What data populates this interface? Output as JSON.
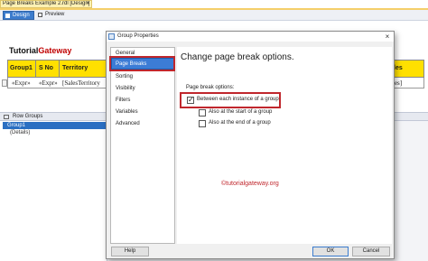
{
  "document": {
    "tab_title": "Page Breaks Example 2.rdl [Design]",
    "tab_close": "×",
    "design_label": "Design",
    "preview_label": "Preview"
  },
  "report": {
    "logo_part1": "Tutorial",
    "logo_part2": "Gateway",
    "headers": [
      "Group1",
      "S No",
      "Territory",
      "les"
    ],
    "cells": [
      "«Expr»",
      "«Expr»",
      "[SalesTerritory",
      "les]"
    ]
  },
  "groups_panel": {
    "title": "Row Groups",
    "group_item": "Group1",
    "details_item": "(Details)"
  },
  "dialog": {
    "title": "Group Properties",
    "close": "×",
    "nav": [
      "General",
      "Page Breaks",
      "Sorting",
      "Visibility",
      "Filters",
      "Variables",
      "Advanced"
    ],
    "selected_nav": "Page Breaks",
    "heading": "Change page break options.",
    "section_label": "Page break options:",
    "options": [
      {
        "label": "Between each instance of a group",
        "checked": true
      },
      {
        "label": "Also at the start of a group",
        "checked": false
      },
      {
        "label": "Also at the end of a group",
        "checked": false
      }
    ],
    "watermark": "©tutorialgateway.org",
    "help_label": "Help",
    "ok_label": "OK",
    "cancel_label": "Cancel"
  },
  "colors": {
    "accent": "#3c7cd6",
    "highlight_box": "#c0272d",
    "header_fill": "#ffe000"
  }
}
